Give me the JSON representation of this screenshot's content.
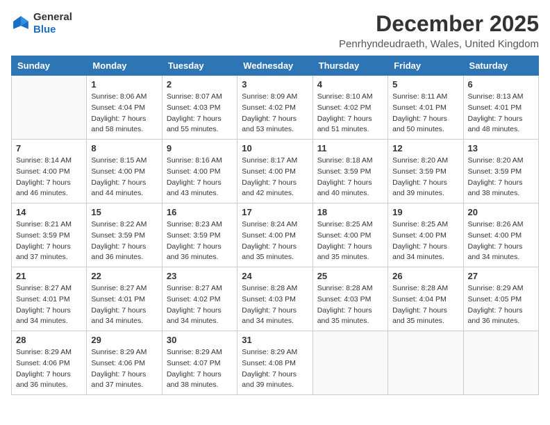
{
  "logo": {
    "general": "General",
    "blue": "Blue"
  },
  "header": {
    "month": "December 2025",
    "location": "Penrhyndeudraeth, Wales, United Kingdom"
  },
  "weekdays": [
    "Sunday",
    "Monday",
    "Tuesday",
    "Wednesday",
    "Thursday",
    "Friday",
    "Saturday"
  ],
  "weeks": [
    [
      {
        "day": "",
        "sunrise": "",
        "sunset": "",
        "daylight": ""
      },
      {
        "day": "1",
        "sunrise": "Sunrise: 8:06 AM",
        "sunset": "Sunset: 4:04 PM",
        "daylight": "Daylight: 7 hours and 58 minutes."
      },
      {
        "day": "2",
        "sunrise": "Sunrise: 8:07 AM",
        "sunset": "Sunset: 4:03 PM",
        "daylight": "Daylight: 7 hours and 55 minutes."
      },
      {
        "day": "3",
        "sunrise": "Sunrise: 8:09 AM",
        "sunset": "Sunset: 4:02 PM",
        "daylight": "Daylight: 7 hours and 53 minutes."
      },
      {
        "day": "4",
        "sunrise": "Sunrise: 8:10 AM",
        "sunset": "Sunset: 4:02 PM",
        "daylight": "Daylight: 7 hours and 51 minutes."
      },
      {
        "day": "5",
        "sunrise": "Sunrise: 8:11 AM",
        "sunset": "Sunset: 4:01 PM",
        "daylight": "Daylight: 7 hours and 50 minutes."
      },
      {
        "day": "6",
        "sunrise": "Sunrise: 8:13 AM",
        "sunset": "Sunset: 4:01 PM",
        "daylight": "Daylight: 7 hours and 48 minutes."
      }
    ],
    [
      {
        "day": "7",
        "sunrise": "Sunrise: 8:14 AM",
        "sunset": "Sunset: 4:00 PM",
        "daylight": "Daylight: 7 hours and 46 minutes."
      },
      {
        "day": "8",
        "sunrise": "Sunrise: 8:15 AM",
        "sunset": "Sunset: 4:00 PM",
        "daylight": "Daylight: 7 hours and 44 minutes."
      },
      {
        "day": "9",
        "sunrise": "Sunrise: 8:16 AM",
        "sunset": "Sunset: 4:00 PM",
        "daylight": "Daylight: 7 hours and 43 minutes."
      },
      {
        "day": "10",
        "sunrise": "Sunrise: 8:17 AM",
        "sunset": "Sunset: 4:00 PM",
        "daylight": "Daylight: 7 hours and 42 minutes."
      },
      {
        "day": "11",
        "sunrise": "Sunrise: 8:18 AM",
        "sunset": "Sunset: 3:59 PM",
        "daylight": "Daylight: 7 hours and 40 minutes."
      },
      {
        "day": "12",
        "sunrise": "Sunrise: 8:20 AM",
        "sunset": "Sunset: 3:59 PM",
        "daylight": "Daylight: 7 hours and 39 minutes."
      },
      {
        "day": "13",
        "sunrise": "Sunrise: 8:20 AM",
        "sunset": "Sunset: 3:59 PM",
        "daylight": "Daylight: 7 hours and 38 minutes."
      }
    ],
    [
      {
        "day": "14",
        "sunrise": "Sunrise: 8:21 AM",
        "sunset": "Sunset: 3:59 PM",
        "daylight": "Daylight: 7 hours and 37 minutes."
      },
      {
        "day": "15",
        "sunrise": "Sunrise: 8:22 AM",
        "sunset": "Sunset: 3:59 PM",
        "daylight": "Daylight: 7 hours and 36 minutes."
      },
      {
        "day": "16",
        "sunrise": "Sunrise: 8:23 AM",
        "sunset": "Sunset: 3:59 PM",
        "daylight": "Daylight: 7 hours and 36 minutes."
      },
      {
        "day": "17",
        "sunrise": "Sunrise: 8:24 AM",
        "sunset": "Sunset: 4:00 PM",
        "daylight": "Daylight: 7 hours and 35 minutes."
      },
      {
        "day": "18",
        "sunrise": "Sunrise: 8:25 AM",
        "sunset": "Sunset: 4:00 PM",
        "daylight": "Daylight: 7 hours and 35 minutes."
      },
      {
        "day": "19",
        "sunrise": "Sunrise: 8:25 AM",
        "sunset": "Sunset: 4:00 PM",
        "daylight": "Daylight: 7 hours and 34 minutes."
      },
      {
        "day": "20",
        "sunrise": "Sunrise: 8:26 AM",
        "sunset": "Sunset: 4:00 PM",
        "daylight": "Daylight: 7 hours and 34 minutes."
      }
    ],
    [
      {
        "day": "21",
        "sunrise": "Sunrise: 8:27 AM",
        "sunset": "Sunset: 4:01 PM",
        "daylight": "Daylight: 7 hours and 34 minutes."
      },
      {
        "day": "22",
        "sunrise": "Sunrise: 8:27 AM",
        "sunset": "Sunset: 4:01 PM",
        "daylight": "Daylight: 7 hours and 34 minutes."
      },
      {
        "day": "23",
        "sunrise": "Sunrise: 8:27 AM",
        "sunset": "Sunset: 4:02 PM",
        "daylight": "Daylight: 7 hours and 34 minutes."
      },
      {
        "day": "24",
        "sunrise": "Sunrise: 8:28 AM",
        "sunset": "Sunset: 4:03 PM",
        "daylight": "Daylight: 7 hours and 34 minutes."
      },
      {
        "day": "25",
        "sunrise": "Sunrise: 8:28 AM",
        "sunset": "Sunset: 4:03 PM",
        "daylight": "Daylight: 7 hours and 35 minutes."
      },
      {
        "day": "26",
        "sunrise": "Sunrise: 8:28 AM",
        "sunset": "Sunset: 4:04 PM",
        "daylight": "Daylight: 7 hours and 35 minutes."
      },
      {
        "day": "27",
        "sunrise": "Sunrise: 8:29 AM",
        "sunset": "Sunset: 4:05 PM",
        "daylight": "Daylight: 7 hours and 36 minutes."
      }
    ],
    [
      {
        "day": "28",
        "sunrise": "Sunrise: 8:29 AM",
        "sunset": "Sunset: 4:06 PM",
        "daylight": "Daylight: 7 hours and 36 minutes."
      },
      {
        "day": "29",
        "sunrise": "Sunrise: 8:29 AM",
        "sunset": "Sunset: 4:06 PM",
        "daylight": "Daylight: 7 hours and 37 minutes."
      },
      {
        "day": "30",
        "sunrise": "Sunrise: 8:29 AM",
        "sunset": "Sunset: 4:07 PM",
        "daylight": "Daylight: 7 hours and 38 minutes."
      },
      {
        "day": "31",
        "sunrise": "Sunrise: 8:29 AM",
        "sunset": "Sunset: 4:08 PM",
        "daylight": "Daylight: 7 hours and 39 minutes."
      },
      {
        "day": "",
        "sunrise": "",
        "sunset": "",
        "daylight": ""
      },
      {
        "day": "",
        "sunrise": "",
        "sunset": "",
        "daylight": ""
      },
      {
        "day": "",
        "sunrise": "",
        "sunset": "",
        "daylight": ""
      }
    ]
  ]
}
